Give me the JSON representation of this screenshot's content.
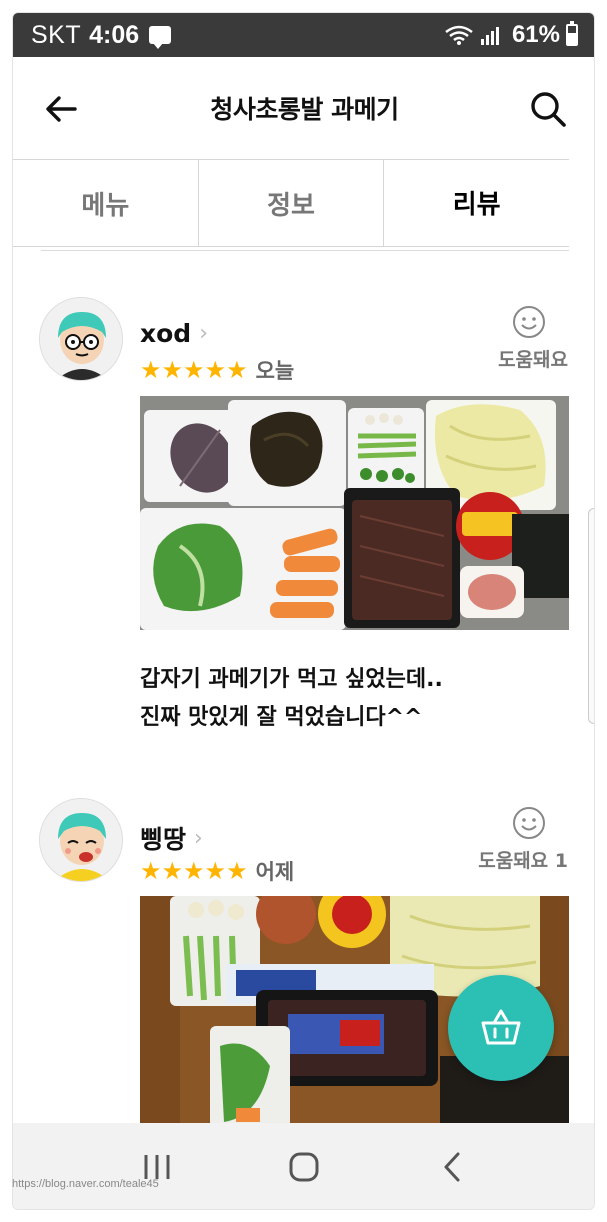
{
  "status_bar": {
    "carrier": "SKT",
    "time": "4:06",
    "battery": "61%",
    "icons": [
      "chat-icon",
      "wifi-icon",
      "signal-icon",
      "battery-icon"
    ]
  },
  "header": {
    "title": "청사초롱발 과메기",
    "back_icon": "arrow-left-icon",
    "search_icon": "search-icon"
  },
  "tabs": [
    {
      "label": "메뉴",
      "active": false
    },
    {
      "label": "정보",
      "active": false
    },
    {
      "label": "리뷰",
      "active": true
    }
  ],
  "reviews": [
    {
      "user": "xod",
      "rating": 5,
      "date": "오늘",
      "helpful_label": "도움돼요",
      "text": "갑자기 과메기가 먹고 싶었는데..\n진짜 맛있게 잘 먹었습니다^^"
    },
    {
      "user": "삥땅",
      "rating": 5,
      "date": "어제",
      "helpful_label": "도움돼요 1",
      "text": ""
    }
  ],
  "fab": {
    "icon": "shopping-basket-icon"
  },
  "nav_bar": {
    "buttons": [
      "recent-apps-icon",
      "home-icon",
      "back-icon"
    ]
  },
  "watermark": "https://blog.naver.com/teale45",
  "colors": {
    "accent": "#2cbfb4",
    "star": "#ffb400",
    "status_bar": "#3a3a3a"
  }
}
